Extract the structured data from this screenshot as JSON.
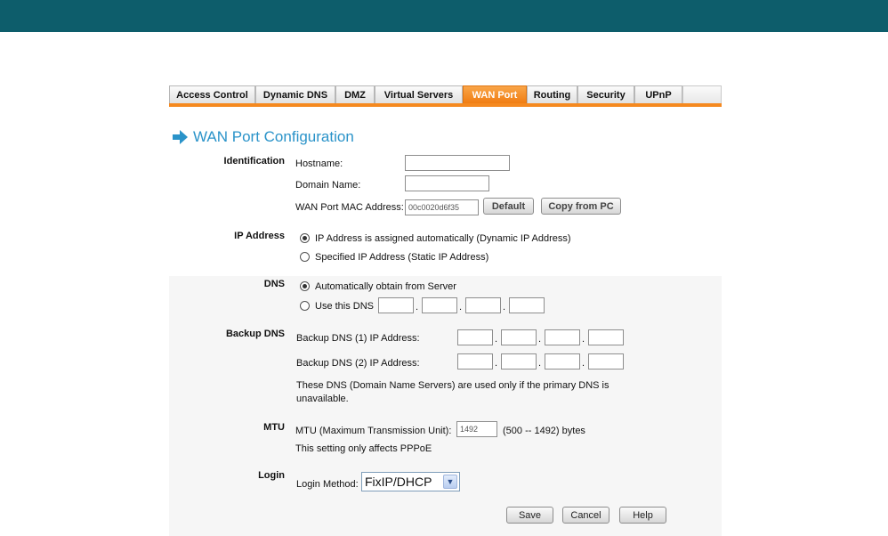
{
  "tabs": [
    {
      "label": "Access Control",
      "active": false
    },
    {
      "label": "Dynamic DNS",
      "active": false
    },
    {
      "label": "DMZ",
      "active": false
    },
    {
      "label": "Virtual Servers",
      "active": false
    },
    {
      "label": "WAN Port",
      "active": true
    },
    {
      "label": "Routing",
      "active": false
    },
    {
      "label": "Security",
      "active": false
    },
    {
      "label": "UPnP",
      "active": false
    }
  ],
  "page_title": "WAN Port Configuration",
  "identification": {
    "section_label": "Identification",
    "hostname_label": "Hostname:",
    "hostname_value": "",
    "domain_label": "Domain Name:",
    "domain_value": "",
    "mac_label": "WAN Port MAC Address:",
    "mac_value": "00c0020d6f35",
    "default_button": "Default",
    "copy_button": "Copy from PC"
  },
  "ip_address": {
    "section_label": "IP Address",
    "option_dynamic": "IP Address is assigned automatically (Dynamic IP Address)",
    "option_static": "Specified IP Address (Static IP Address)",
    "selected": "dynamic"
  },
  "dns": {
    "section_label": "DNS",
    "option_auto": "Automatically obtain from Server",
    "option_manual": "Use this DNS",
    "selected": "auto"
  },
  "backup_dns": {
    "section_label": "Backup DNS",
    "dns1_label": "Backup DNS (1) IP Address:",
    "dns2_label": "Backup DNS (2) IP Address:",
    "note": "These DNS (Domain Name Servers) are used only if the primary DNS is",
    "note_cont": "unavailable."
  },
  "mtu": {
    "section_label": "MTU",
    "label": "MTU (Maximum Transmission Unit):",
    "value": "1492",
    "range": "(500 -- 1492) bytes",
    "note": "This setting only affects PPPoE"
  },
  "login": {
    "section_label": "Login",
    "method_label": "Login Method:",
    "method_value": "FixIP/DHCP"
  },
  "buttons": {
    "save": "Save",
    "cancel": "Cancel",
    "help": "Help"
  },
  "colors": {
    "topbar": "#0d5d6b",
    "accent_orange": "#f5891f",
    "title_blue": "#2a93c9"
  }
}
